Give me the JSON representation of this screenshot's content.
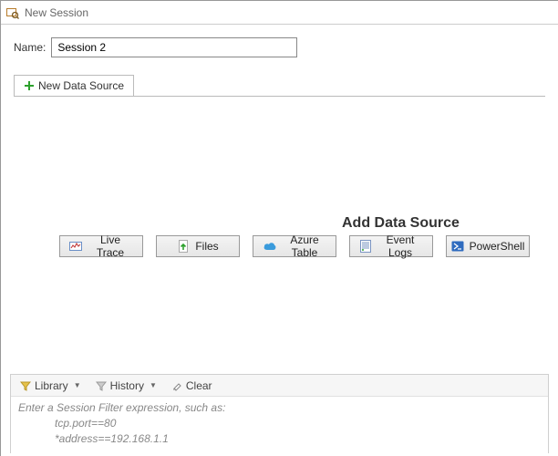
{
  "window": {
    "title": "New Session"
  },
  "form": {
    "name_label": "Name:",
    "name_value": "Session 2"
  },
  "tabs": {
    "new_ds_label": "New Data Source"
  },
  "datasource": {
    "heading": "Add Data Source",
    "buttons": {
      "live_trace": "Live Trace",
      "files": "Files",
      "azure_table": "Azure Table",
      "event_logs": "Event Logs",
      "powershell": "PowerShell"
    }
  },
  "filter": {
    "library_label": "Library",
    "history_label": "History",
    "clear_label": "Clear",
    "placeholder_line1": "Enter a Session Filter expression, such as:",
    "placeholder_line2": "tcp.port==80",
    "placeholder_line3": "*address==192.168.1.1"
  }
}
